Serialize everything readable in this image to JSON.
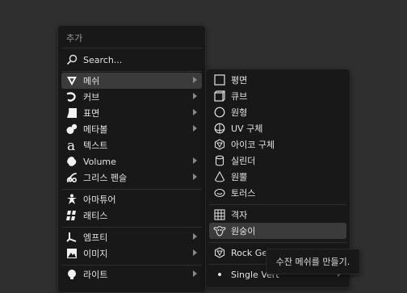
{
  "add_menu": {
    "title": "추가",
    "search_label": "Search...",
    "items": [
      {
        "label": "메쉬",
        "icon": "mesh-icon",
        "has_submenu": true,
        "active": true
      },
      {
        "label": "커브",
        "icon": "curve-icon",
        "has_submenu": true
      },
      {
        "label": "표면",
        "icon": "surface-icon",
        "has_submenu": true
      },
      {
        "label": "메타볼",
        "icon": "metaball-icon",
        "has_submenu": true
      },
      {
        "label": "텍스트",
        "icon": "text-icon",
        "has_submenu": false
      },
      {
        "label": "Volume",
        "icon": "volume-icon",
        "has_submenu": true
      },
      {
        "label": "그리스 펜슬",
        "icon": "grease-pencil-icon",
        "has_submenu": true
      },
      {
        "label": "아마튜어",
        "icon": "armature-icon",
        "has_submenu": false
      },
      {
        "label": "래티스",
        "icon": "lattice-icon",
        "has_submenu": false
      },
      {
        "label": "엠프티",
        "icon": "empty-icon",
        "has_submenu": true
      },
      {
        "label": "이미지",
        "icon": "image-icon",
        "has_submenu": true
      },
      {
        "label": "라이트",
        "icon": "light-icon",
        "has_submenu": true
      }
    ]
  },
  "mesh_menu": {
    "items": [
      {
        "label": "평면",
        "icon": "plane-icon"
      },
      {
        "label": "큐브",
        "icon": "cube-icon"
      },
      {
        "label": "원형",
        "icon": "circle-icon"
      },
      {
        "label": "UV 구체",
        "icon": "uv-sphere-icon"
      },
      {
        "label": "아이코 구체",
        "icon": "ico-sphere-icon"
      },
      {
        "label": "실린더",
        "icon": "cylinder-icon"
      },
      {
        "label": "원뿔",
        "icon": "cone-icon"
      },
      {
        "label": "토러스",
        "icon": "torus-icon"
      },
      {
        "label": "격자",
        "icon": "grid-icon"
      },
      {
        "label": "원숭이",
        "icon": "monkey-icon",
        "active": true
      },
      {
        "label": "Rock Ge",
        "icon": "rock-icon"
      },
      {
        "label": "Single Vert",
        "icon": "vertex-icon",
        "has_submenu": true
      }
    ]
  },
  "tooltip": {
    "text": "수잔 메쉬를 만들기."
  },
  "colors": {
    "background": "#2f2f2f",
    "menu_bg": "#181818",
    "highlight": "#3b3b3b",
    "text": "#e3e3e3",
    "muted": "#9a9a9a"
  }
}
